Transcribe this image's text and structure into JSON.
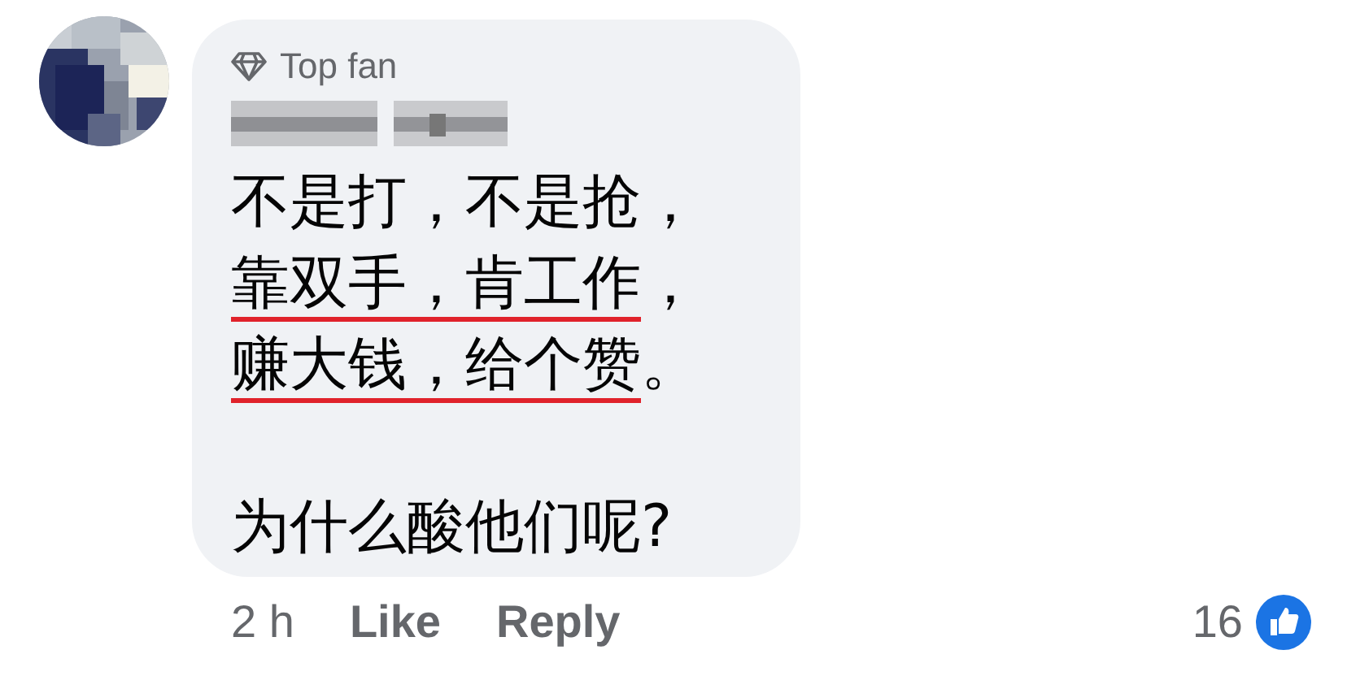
{
  "comment": {
    "badge": "Top fan",
    "paragraphs": [
      {
        "lines": [
          {
            "parts": [
              {
                "text": "不是打，不是抢，",
                "underlined": false
              }
            ]
          },
          {
            "parts": [
              {
                "text": "靠双手，肯工作",
                "underlined": true
              },
              {
                "text": "，",
                "underlined": false
              }
            ]
          },
          {
            "parts": [
              {
                "text": "赚大钱，给个赞",
                "underlined": true
              },
              {
                "text": "。",
                "underlined": false
              }
            ]
          }
        ]
      },
      {
        "lines": [
          {
            "parts": [
              {
                "text": "为什么酸他们呢?",
                "underlined": false
              }
            ]
          }
        ]
      }
    ],
    "footer": {
      "time": "2 h",
      "actions": [
        "Like",
        "Reply"
      ],
      "reaction_count": "16"
    }
  }
}
